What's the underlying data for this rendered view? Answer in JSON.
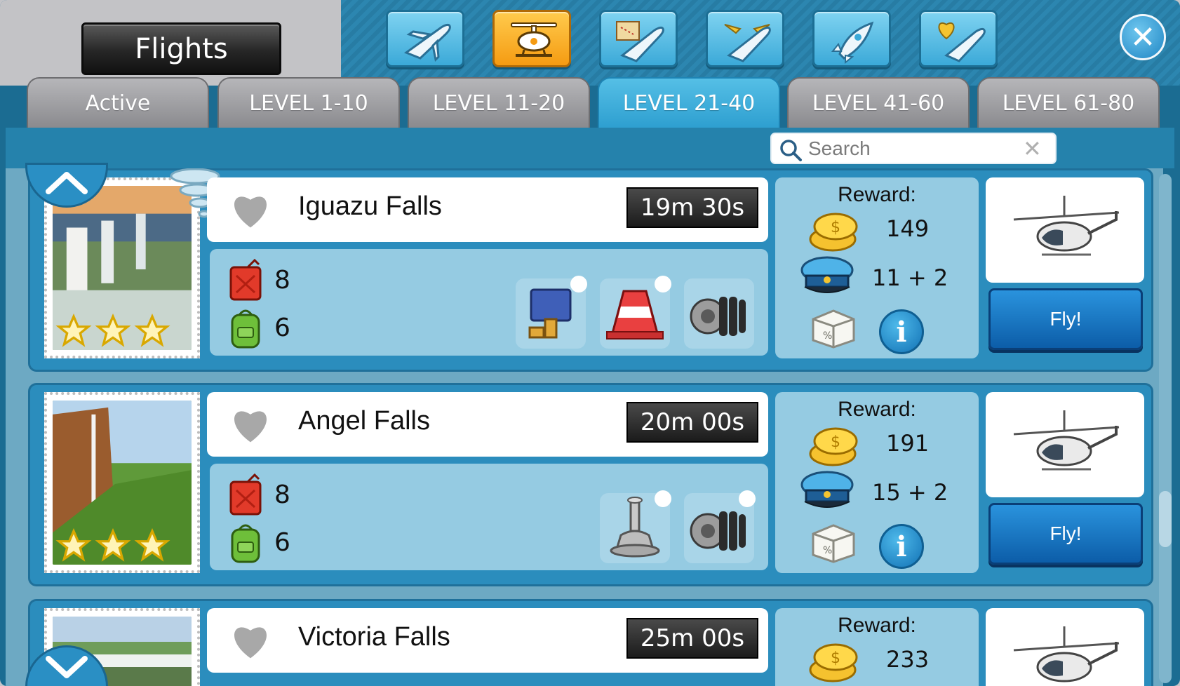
{
  "header": {
    "title": "Flights",
    "categories": [
      {
        "name": "plane-icon",
        "active": false
      },
      {
        "name": "helicopter-icon",
        "active": true
      },
      {
        "name": "map-plane-icon",
        "active": false
      },
      {
        "name": "winged-plane-icon",
        "active": false
      },
      {
        "name": "rocket-icon",
        "active": false
      },
      {
        "name": "heart-plane-icon",
        "active": false
      }
    ],
    "close_icon": "close-icon"
  },
  "tabs": [
    {
      "label": "Active",
      "active": false
    },
    {
      "label": "LEVEL 1-10",
      "active": false
    },
    {
      "label": "LEVEL 11-20",
      "active": false
    },
    {
      "label": "LEVEL 21-40",
      "active": true
    },
    {
      "label": "LEVEL 41-60",
      "active": false
    },
    {
      "label": "LEVEL 61-80",
      "active": false
    }
  ],
  "search": {
    "placeholder": "Search"
  },
  "flights": [
    {
      "name": "Iguazu Falls",
      "time": "19m 30s",
      "fuel": "8",
      "passengers": "6",
      "parts": [
        "valve-part-icon",
        "cone-part-icon",
        "engine-part-icon"
      ],
      "reward_label": "Reward:",
      "coins": "149",
      "xp": "11 + 2",
      "fly_label": "Fly!",
      "stars": 3
    },
    {
      "name": "Angel Falls",
      "time": "20m 00s",
      "fuel": "8",
      "passengers": "6",
      "parts": [
        "piston-part-icon",
        "engine-part-icon"
      ],
      "reward_label": "Reward:",
      "coins": "191",
      "xp": "15 + 2",
      "fly_label": "Fly!",
      "stars": 3
    },
    {
      "name": "Victoria Falls",
      "time": "25m 00s",
      "reward_label": "Reward:",
      "coins": "233"
    }
  ],
  "colors": {
    "frame": "#1b6c92",
    "active_tab": "#2e9fd0",
    "active_category": "#f59b12",
    "fly_button": "#0c5da8"
  }
}
